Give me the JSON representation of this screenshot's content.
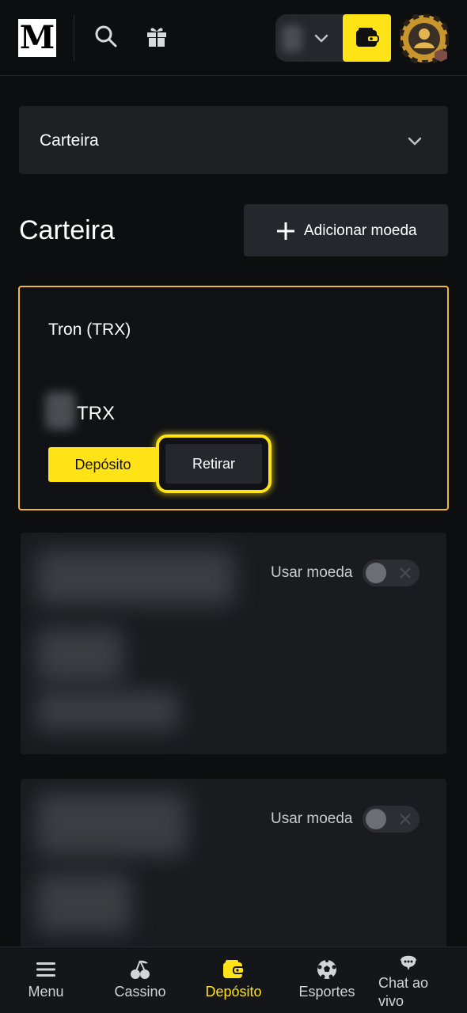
{
  "header": {
    "logo_text": "M",
    "icons": [
      "search-icon",
      "gift-icon",
      "chevron-down-icon",
      "wallet-icon",
      "avatar-icon"
    ],
    "accent_color": "#ffe316"
  },
  "dropdown": {
    "selected": "Carteira"
  },
  "page": {
    "title": "Carteira",
    "add_currency_label": "Adicionar moeda"
  },
  "main_card": {
    "coin_name": "Tron (TRX)",
    "ticker": "TRX",
    "deposit_label": "Depósito",
    "withdraw_label": "Retirar",
    "border_color": "#f0b73a"
  },
  "coin_cards": [
    {
      "use_label": "Usar moeda",
      "enabled": false
    },
    {
      "use_label": "Usar moeda",
      "enabled": false
    }
  ],
  "bottom_nav": {
    "items": [
      {
        "label": "Menu",
        "icon": "menu-icon"
      },
      {
        "label": "Cassino",
        "icon": "cherries-icon"
      },
      {
        "label": "Depósito",
        "icon": "wallet-icon",
        "active": true
      },
      {
        "label": "Esportes",
        "icon": "soccer-ball-icon"
      },
      {
        "label": "Chat ao vivo",
        "icon": "chat-support-icon"
      }
    ]
  }
}
